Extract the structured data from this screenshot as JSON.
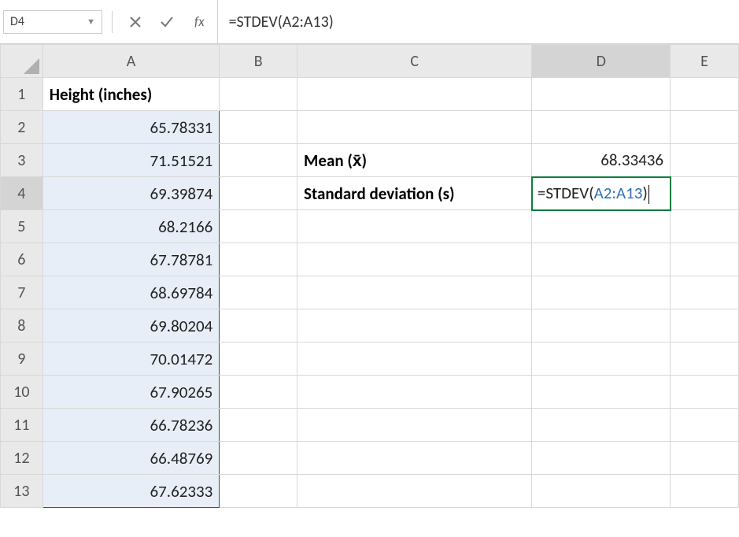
{
  "nameBox": {
    "value": "D4"
  },
  "formulaBar": {
    "value": "=STDEV(A2:A13)"
  },
  "columns": [
    "A",
    "B",
    "C",
    "D",
    "E"
  ],
  "rows": {
    "1": {
      "A": "Height (inches)"
    },
    "2": {
      "A": "65.78331"
    },
    "3": {
      "A": "71.51521",
      "C": "Mean (x̄)",
      "D": "68.33436"
    },
    "4": {
      "A": "69.39874",
      "C": "Standard deviation (s)",
      "D_formula_prefix": "=STDEV(",
      "D_formula_ref": "A2:A13",
      "D_formula_suffix": ")"
    },
    "5": {
      "A": "68.2166"
    },
    "6": {
      "A": "67.78781"
    },
    "7": {
      "A": "68.69784"
    },
    "8": {
      "A": "69.80204"
    },
    "9": {
      "A": "70.01472"
    },
    "10": {
      "A": "67.90265"
    },
    "11": {
      "A": "66.78236"
    },
    "12": {
      "A": "66.48769"
    },
    "13": {
      "A": "67.62333"
    }
  },
  "rowNumbers": [
    "1",
    "2",
    "3",
    "4",
    "5",
    "6",
    "7",
    "8",
    "9",
    "10",
    "11",
    "12",
    "13"
  ]
}
